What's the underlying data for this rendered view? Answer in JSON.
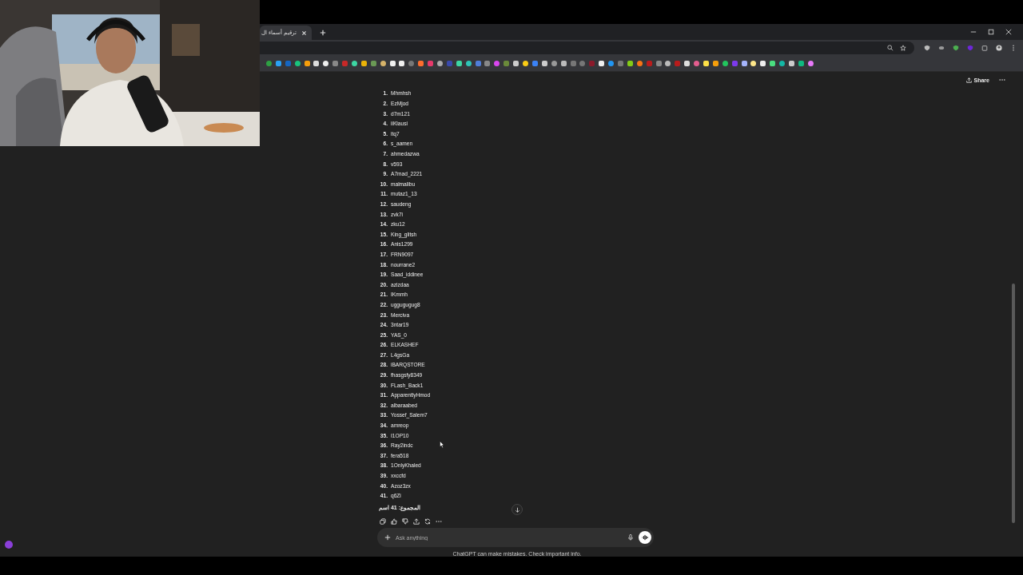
{
  "browser": {
    "tab_title": "ترقيم أسماء ال"
  },
  "chat": {
    "share": "Share",
    "list": [
      {
        "number": "1.",
        "name": "Mhmhsh"
      },
      {
        "number": "2.",
        "name": "EzMjod"
      },
      {
        "number": "3.",
        "name": "d7m121"
      },
      {
        "number": "4.",
        "name": "iiKlausi"
      },
      {
        "number": "5.",
        "name": "itq7"
      },
      {
        "number": "6.",
        "name": "s_aamen"
      },
      {
        "number": "7.",
        "name": "ahmedazwa"
      },
      {
        "number": "8.",
        "name": "v593"
      },
      {
        "number": "9.",
        "name": "A7mad_2221"
      },
      {
        "number": "10.",
        "name": "malmalibu"
      },
      {
        "number": "11.",
        "name": "mutaz1_13"
      },
      {
        "number": "12.",
        "name": "saudeng"
      },
      {
        "number": "13.",
        "name": "zvk7i"
      },
      {
        "number": "14.",
        "name": "zku12"
      },
      {
        "number": "15.",
        "name": "King_glitsh"
      },
      {
        "number": "16.",
        "name": "Anis1299"
      },
      {
        "number": "17.",
        "name": "FRN9097"
      },
      {
        "number": "18.",
        "name": "nourrane2"
      },
      {
        "number": "19.",
        "name": "Saad_iddinee"
      },
      {
        "number": "20.",
        "name": "azizdaa"
      },
      {
        "number": "21.",
        "name": "IKmmh"
      },
      {
        "number": "22.",
        "name": "uggugugug8"
      },
      {
        "number": "23.",
        "name": "Merciva"
      },
      {
        "number": "24.",
        "name": "3ntar19"
      },
      {
        "number": "25.",
        "name": "YAS_0"
      },
      {
        "number": "26.",
        "name": "ELKASHEF"
      },
      {
        "number": "27.",
        "name": "L4gsGa"
      },
      {
        "number": "28.",
        "name": "iBARQSTORE"
      },
      {
        "number": "29.",
        "name": "fhasgsfy8349"
      },
      {
        "number": "30.",
        "name": "FLash_Back1"
      },
      {
        "number": "31.",
        "name": "ApparentlyHmod"
      },
      {
        "number": "32.",
        "name": "albaraabed"
      },
      {
        "number": "33.",
        "name": "Yossef_Salem7"
      },
      {
        "number": "34.",
        "name": "amreop"
      },
      {
        "number": "35.",
        "name": "I1OP10"
      },
      {
        "number": "36.",
        "name": "Ray2indc"
      },
      {
        "number": "37.",
        "name": "fera518"
      },
      {
        "number": "38.",
        "name": "1OnlyKhaled"
      },
      {
        "number": "39.",
        "name": "xxccfd"
      },
      {
        "number": "40.",
        "name": "Azoz3zx"
      },
      {
        "number": "41.",
        "name": "q6Zi"
      }
    ],
    "total": "المجموع: 41 اسم",
    "composer": {
      "placeholder": "Ask anything"
    },
    "disclaimer": "ChatGPT can make mistakes. Check important info."
  }
}
